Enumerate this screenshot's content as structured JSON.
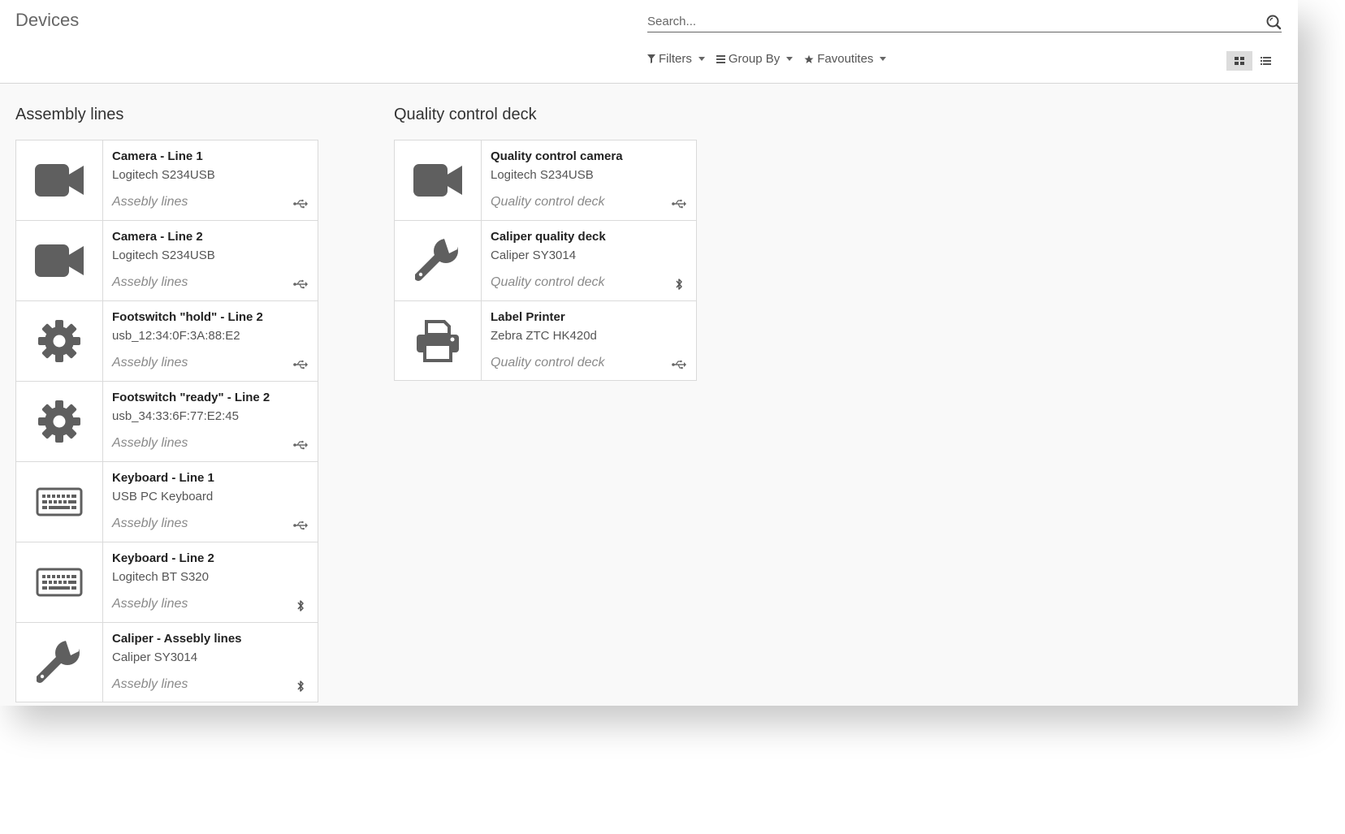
{
  "header": {
    "title": "Devices",
    "search_placeholder": "Search...",
    "filters_label": "Filters",
    "groupby_label": "Group By",
    "favourites_label": "Favoutites"
  },
  "groups": [
    {
      "title": "Assembly lines",
      "devices": [
        {
          "name": "Camera - Line 1",
          "model": "Logitech S234USB",
          "location": "Assebly lines",
          "icon": "camera-icon",
          "connection": "usb-icon"
        },
        {
          "name": "Camera - Line 2",
          "model": "Logitech S234USB",
          "location": "Assebly lines",
          "icon": "camera-icon",
          "connection": "usb-icon"
        },
        {
          "name": "Footswitch \"hold\" - Line 2",
          "model": "usb_12:34:0F:3A:88:E2",
          "location": "Assebly lines",
          "icon": "gear-icon",
          "connection": "usb-icon"
        },
        {
          "name": "Footswitch \"ready\" - Line 2",
          "model": "usb_34:33:6F:77:E2:45",
          "location": "Assebly lines",
          "icon": "gear-icon",
          "connection": "usb-icon"
        },
        {
          "name": "Keyboard - Line 1",
          "model": "USB PC Keyboard",
          "location": "Assebly lines",
          "icon": "keyboard-icon",
          "connection": "usb-icon"
        },
        {
          "name": "Keyboard - Line 2",
          "model": "Logitech BT S320",
          "location": "Assebly lines",
          "icon": "keyboard-icon",
          "connection": "bluetooth-icon"
        },
        {
          "name": "Caliper - Assebly lines",
          "model": "Caliper SY3014",
          "location": "Assebly lines",
          "icon": "wrench-icon",
          "connection": "bluetooth-icon"
        }
      ]
    },
    {
      "title": "Quality control deck",
      "devices": [
        {
          "name": "Quality control camera",
          "model": "Logitech S234USB",
          "location": "Quality control deck",
          "icon": "camera-icon",
          "connection": "usb-icon"
        },
        {
          "name": "Caliper quality deck",
          "model": "Caliper SY3014",
          "location": "Quality control deck",
          "icon": "wrench-icon",
          "connection": "bluetooth-icon"
        },
        {
          "name": "Label Printer",
          "model": "Zebra ZTC HK420d",
          "location": "Quality control deck",
          "icon": "printer-icon",
          "connection": "usb-icon"
        }
      ]
    }
  ],
  "colors": {
    "icon": "#5f5f5f",
    "background": "#f9f9f9",
    "card_border": "#dadada"
  }
}
